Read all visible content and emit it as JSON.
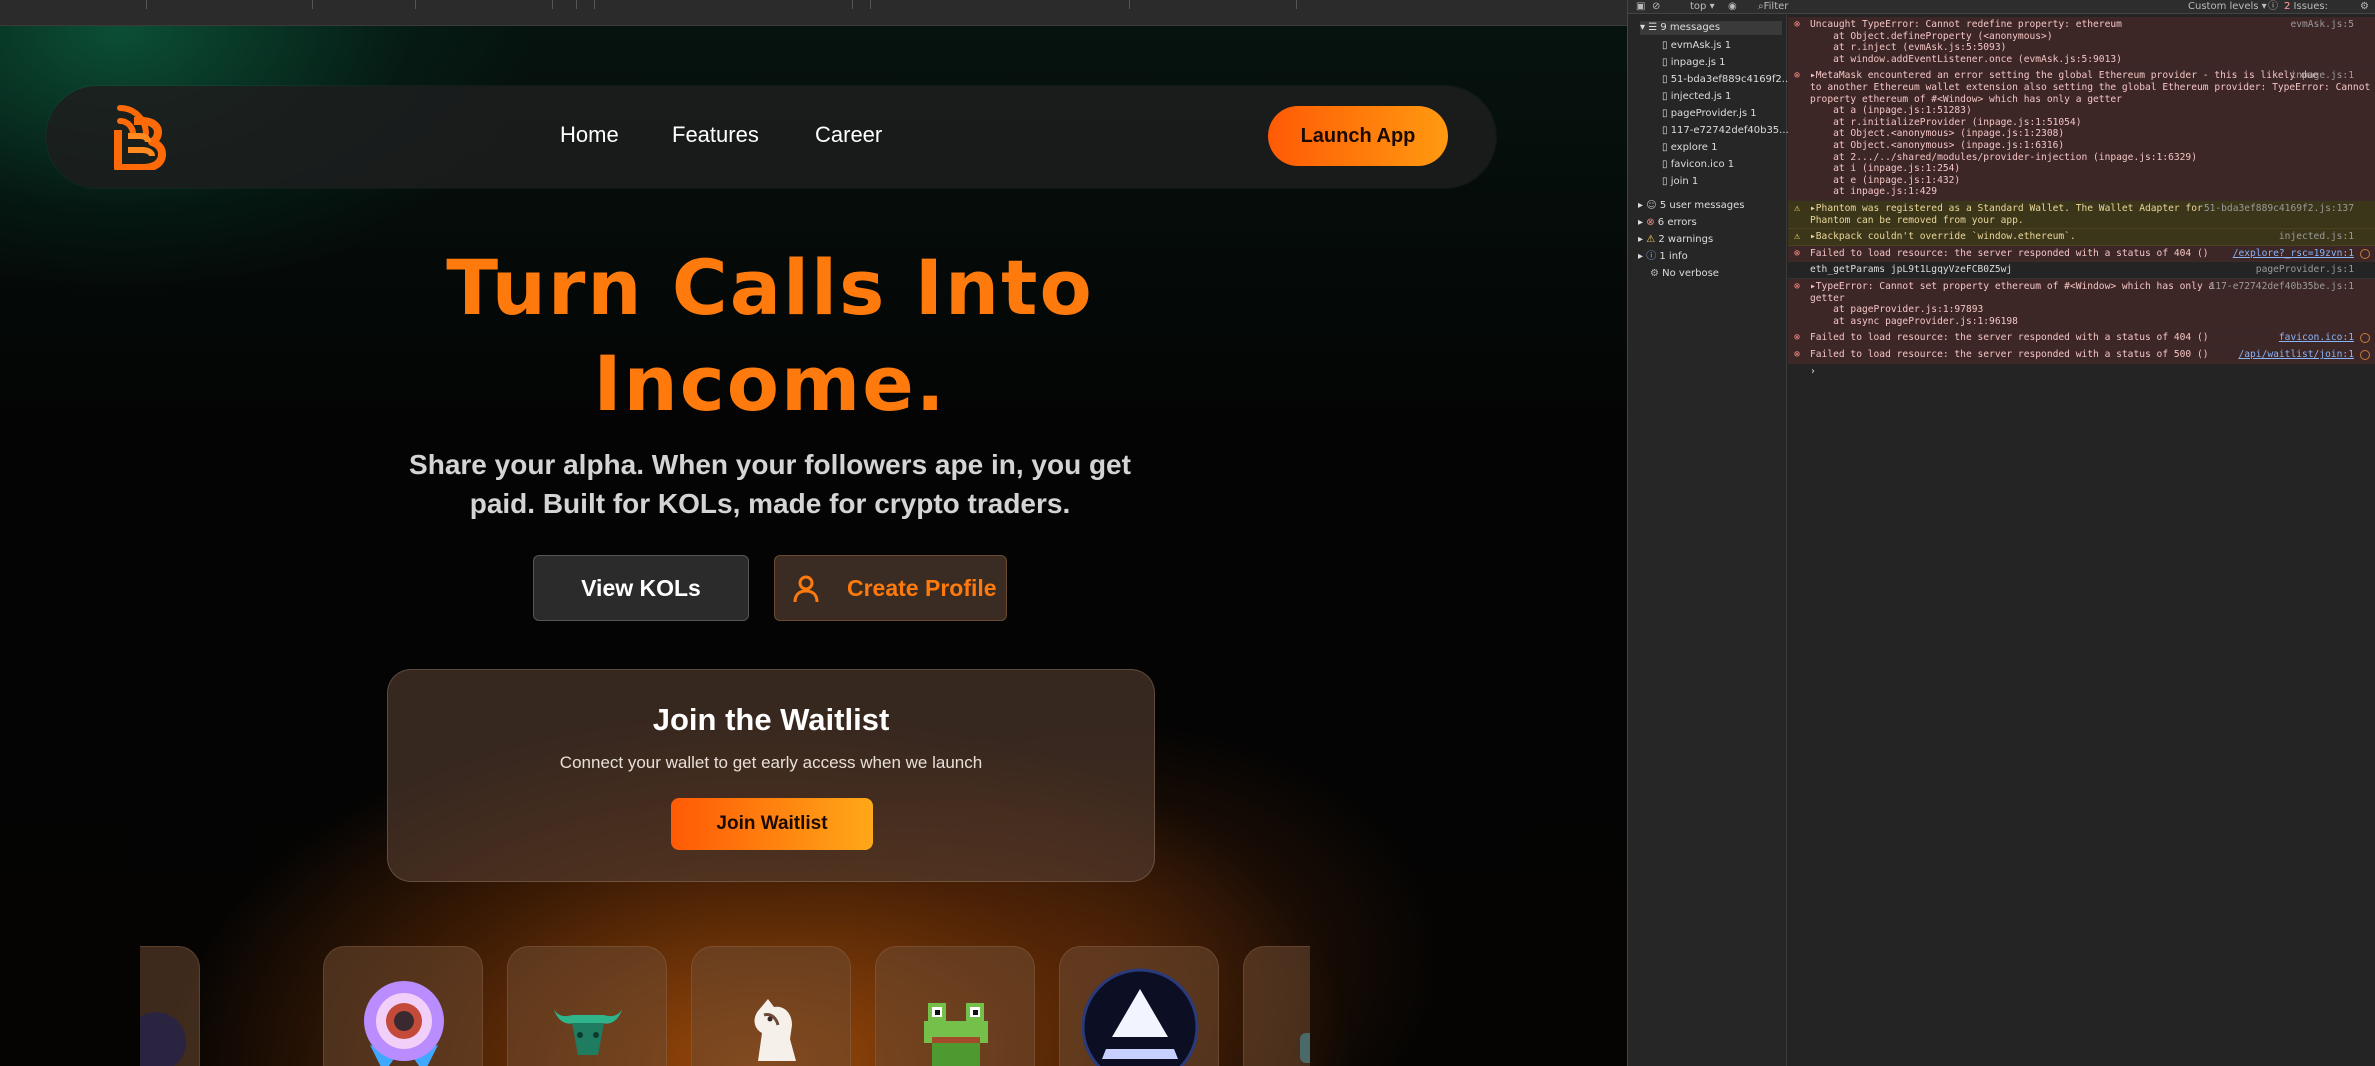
{
  "page": {
    "nav": {
      "logo_letter": "B",
      "links": [
        "Home",
        "Features",
        "Career"
      ],
      "cta": "Launch App"
    },
    "hero": {
      "title_line1": "Turn Calls Into",
      "title_line2": "Income.",
      "subtitle_line1": "Share your alpha. When your followers ape in, you get",
      "subtitle_line2": "paid. Built for KOLs, made for crypto traders.",
      "btn_view": "View KOLs",
      "btn_create": "Create Profile"
    },
    "waitlist": {
      "title": "Join the Waitlist",
      "subtitle": "Connect your wallet to get early access when we launch",
      "button": "Join Waitlist"
    },
    "tokens": [
      "partial-token-icon",
      "ring-token-icon",
      "bull-token-icon",
      "horse-token-icon",
      "frog-token-icon",
      "triangle-token-icon",
      "partial-token-icon"
    ],
    "colors": {
      "accent": "#ff7a0d",
      "accent_end": "#ff9a10",
      "error_bg": "#3d2626",
      "warning_bg": "#3b3519"
    }
  },
  "devtools": {
    "toolbar": {
      "context": "top ▾",
      "filter": "Filter",
      "levels": "Custom levels ▾",
      "issues": "2 Issues:",
      "issues_count": "2"
    },
    "sidebar": {
      "messages": "9 messages",
      "files": [
        {
          "name": "evmAsk.js",
          "count": "1"
        },
        {
          "name": "inpage.js",
          "count": "1"
        },
        {
          "name": "51-bda3ef889c4169f2...",
          "count": ""
        },
        {
          "name": "injected.js",
          "count": "1"
        },
        {
          "name": "pageProvider.js",
          "count": "1"
        },
        {
          "name": "117-e72742def40b35...",
          "count": ""
        },
        {
          "name": "explore",
          "count": "1"
        },
        {
          "name": "favicon.ico",
          "count": "1"
        },
        {
          "name": "join",
          "count": "1"
        }
      ],
      "user_messages": "5 user messages",
      "errors": "6 errors",
      "warnings": "2 warnings",
      "info": "1 info",
      "verbose": "No verbose"
    },
    "logs": [
      {
        "type": "err",
        "text": "Uncaught TypeError: Cannot redefine property: ethereum\n    at Object.defineProperty (<anonymous>)\n    at r.inject (evmAsk.js:5:5093)\n    at window.addEventListener.once (evmAsk.js:5:9013)",
        "src": "evmAsk.js:5"
      },
      {
        "type": "err",
        "text": "▸MetaMask encountered an error setting the global Ethereum provider - this is likely due\nto another Ethereum wallet extension also setting the global Ethereum provider: TypeError: Cannot set\nproperty ethereum of #<Window> which has only a getter\n    at a (inpage.js:1:51283)\n    at r.initializeProvider (inpage.js:1:51054)\n    at Object.<anonymous> (inpage.js:1:2308)\n    at Object.<anonymous> (inpage.js:1:6316)\n    at 2.../../shared/modules/provider-injection (inpage.js:1:6329)\n    at i (inpage.js:1:254)\n    at e (inpage.js:1:432)\n    at inpage.js:1:429",
        "src": "inpage.js:1"
      },
      {
        "type": "warn",
        "text": "▸Phantom was registered as a Standard Wallet. The Wallet Adapter for\nPhantom can be removed from your app.",
        "src": "51-bda3ef889c4169f2.js:137"
      },
      {
        "type": "warn",
        "text": "▸Backpack couldn't override `window.ethereum`.",
        "src": "injected.js:1"
      },
      {
        "type": "err",
        "text": "Failed to load resource: the server responded with a status of 404 ()",
        "src": "/explore?_rsc=19zvn:1"
      },
      {
        "type": "plain",
        "text": "eth_getParams jpL9t1LgqyVzeFCB0Z5wj",
        "src": "pageProvider.js:1"
      },
      {
        "type": "err",
        "text": "▸TypeError: Cannot set property ethereum of #<Window> which has only a\ngetter\n    at pageProvider.js:1:97893\n    at async pageProvider.js:1:96198",
        "src": "117-e72742def40b35be.js:1"
      },
      {
        "type": "err",
        "text": "Failed to load resource: the server responded with a status of 404 ()",
        "src": "favicon.ico:1"
      },
      {
        "type": "err",
        "text": "Failed to load resource: the server responded with a status of 500 ()",
        "src": "/api/waitlist/join:1"
      }
    ],
    "prompt": "›"
  }
}
